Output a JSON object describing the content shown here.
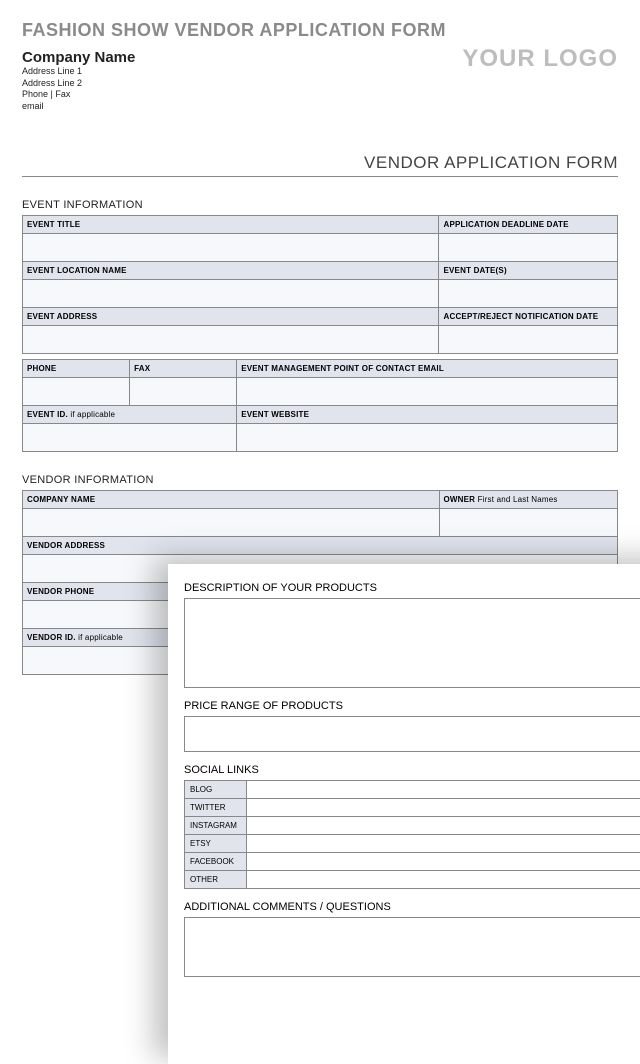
{
  "main_title": "FASHION SHOW VENDOR APPLICATION FORM",
  "company": {
    "name": "Company Name",
    "addr1": "Address Line 1",
    "addr2": "Address Line 2",
    "phone_fax": "Phone | Fax",
    "email": "email"
  },
  "logo_text": "YOUR LOGO",
  "form_title": "VENDOR APPLICATION FORM",
  "event_section_title": "EVENT INFORMATION",
  "event_labels": {
    "title": "EVENT TITLE",
    "deadline": "APPLICATION DEADLINE DATE",
    "location": "EVENT LOCATION NAME",
    "dates": "EVENT DATE(S)",
    "address": "EVENT ADDRESS",
    "notify": "ACCEPT/REJECT NOTIFICATION DATE",
    "phone": "PHONE",
    "fax": "FAX",
    "poc_email": "EVENT MANAGEMENT POINT OF CONTACT EMAIL",
    "event_id": "EVENT ID.",
    "event_id_sub": " if applicable",
    "website": "EVENT WEBSITE"
  },
  "vendor_section_title": "VENDOR INFORMATION",
  "vendor_labels": {
    "company": "COMPANY NAME",
    "owner": "OWNER",
    "owner_sub": "  First and Last Names",
    "address": "VENDOR ADDRESS",
    "phone": "VENDOR PHONE",
    "vendor_id": "VENDOR ID.",
    "vendor_id_sub": " if applicable"
  },
  "page2": {
    "desc_title": "DESCRIPTION OF YOUR PRODUCTS",
    "price_title": "PRICE RANGE OF PRODUCTS",
    "social_title": "SOCIAL LINKS",
    "social_rows": [
      "BLOG",
      "TWITTER",
      "INSTAGRAM",
      "ETSY",
      "FACEBOOK",
      "OTHER"
    ],
    "comments_title": "ADDITIONAL COMMENTS / QUESTIONS"
  }
}
